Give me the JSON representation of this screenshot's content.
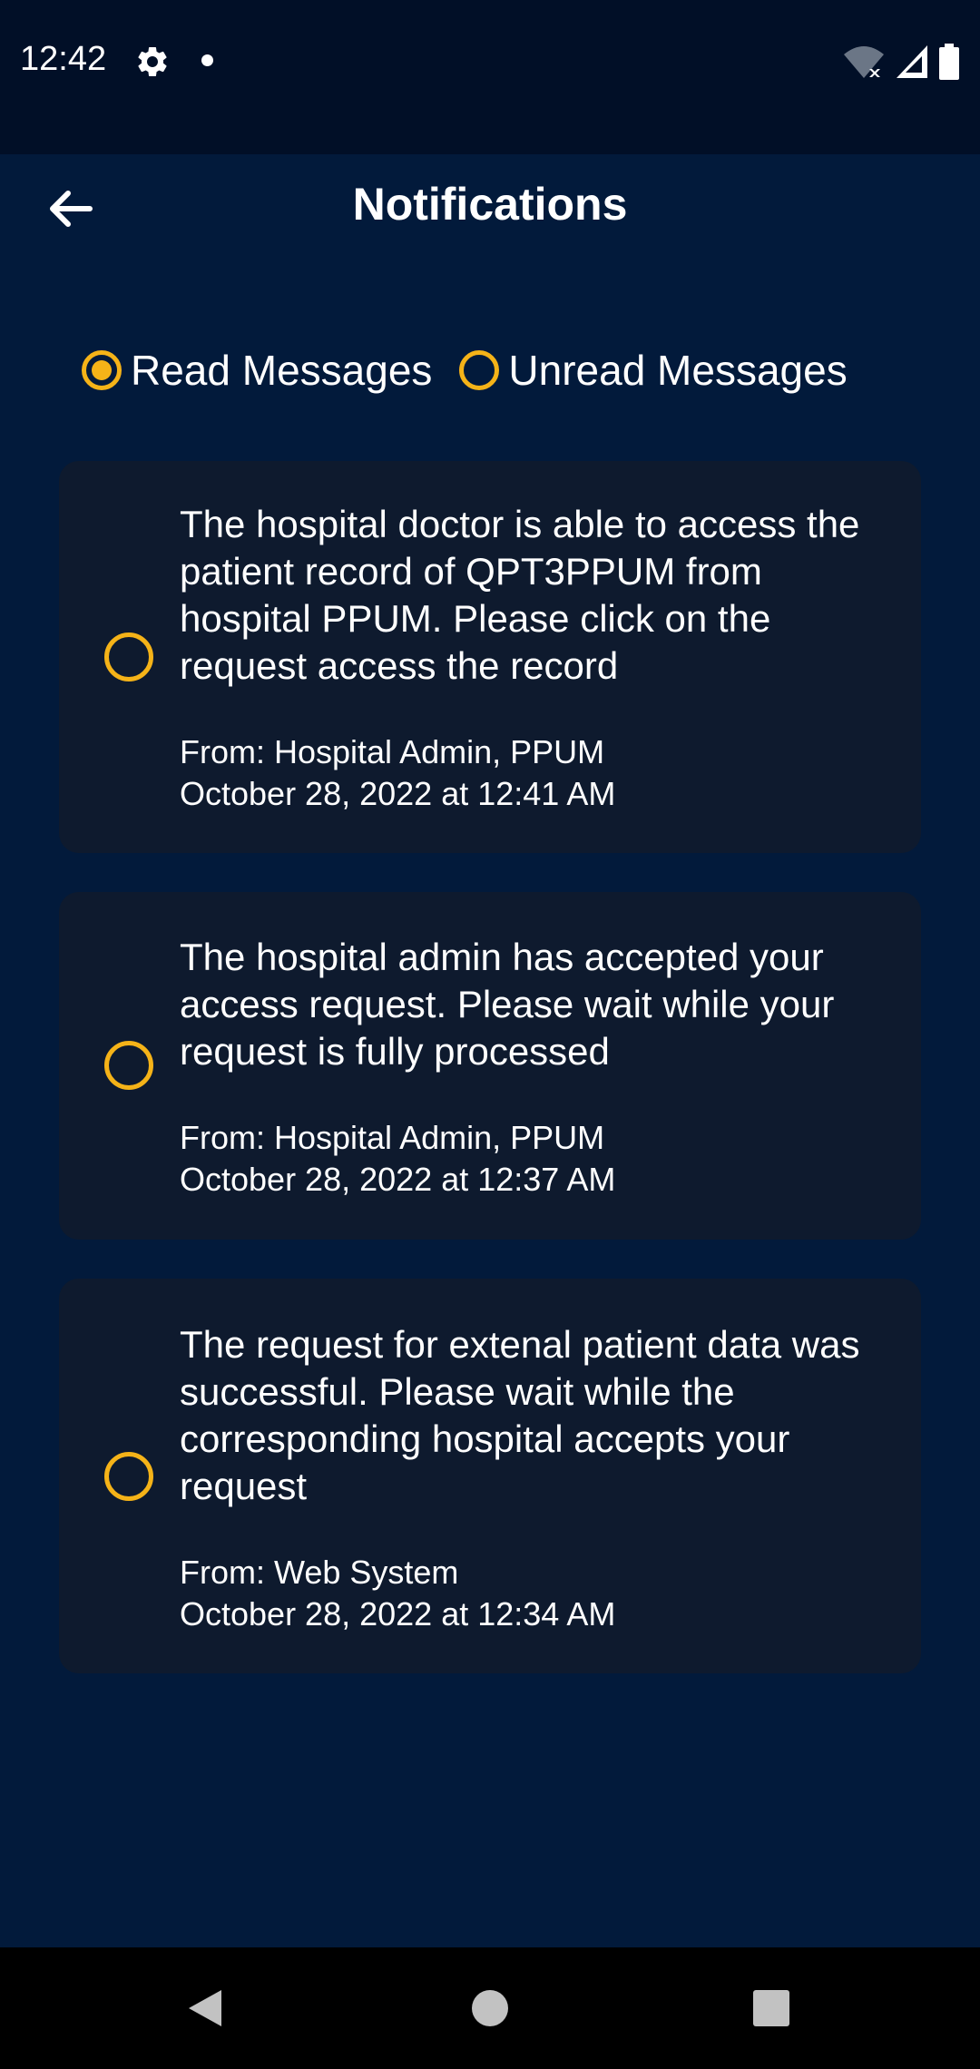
{
  "status_bar": {
    "time": "12:42",
    "icons": [
      "gear-icon",
      "notification-dot-icon",
      "wifi-off-icon",
      "signal-icon",
      "battery-icon"
    ]
  },
  "app_bar": {
    "title": "Notifications",
    "back_icon": "arrow-left-icon"
  },
  "filters": {
    "read_label": "Read Messages",
    "unread_label": "Unread Messages",
    "selected": "read"
  },
  "notifications": [
    {
      "message": "The hospital doctor is able to access the patient record of QPT3PPUM from hospital PPUM. Please click on the request access the record",
      "from": "From: Hospital Admin, PPUM",
      "date": "October 28, 2022 at 12:41 AM"
    },
    {
      "message": "The hospital admin has accepted your access request. Please wait while your request is fully processed",
      "from": "From: Hospital Admin, PPUM",
      "date": "October 28, 2022 at 12:37 AM"
    },
    {
      "message": "The request for extenal patient data was successful. Please wait while the corresponding hospital accepts your request",
      "from": "From: Web System",
      "date": "October 28, 2022 at 12:34 AM"
    }
  ],
  "colors": {
    "background": "#021a3b",
    "status_bar": "#010f27",
    "card": "#0e1a2e",
    "accent": "#f5b318",
    "text": "#ffffff",
    "nav_bar": "#000000"
  },
  "nav": {
    "icons": [
      "back-triangle-icon",
      "home-circle-icon",
      "recents-square-icon"
    ]
  }
}
